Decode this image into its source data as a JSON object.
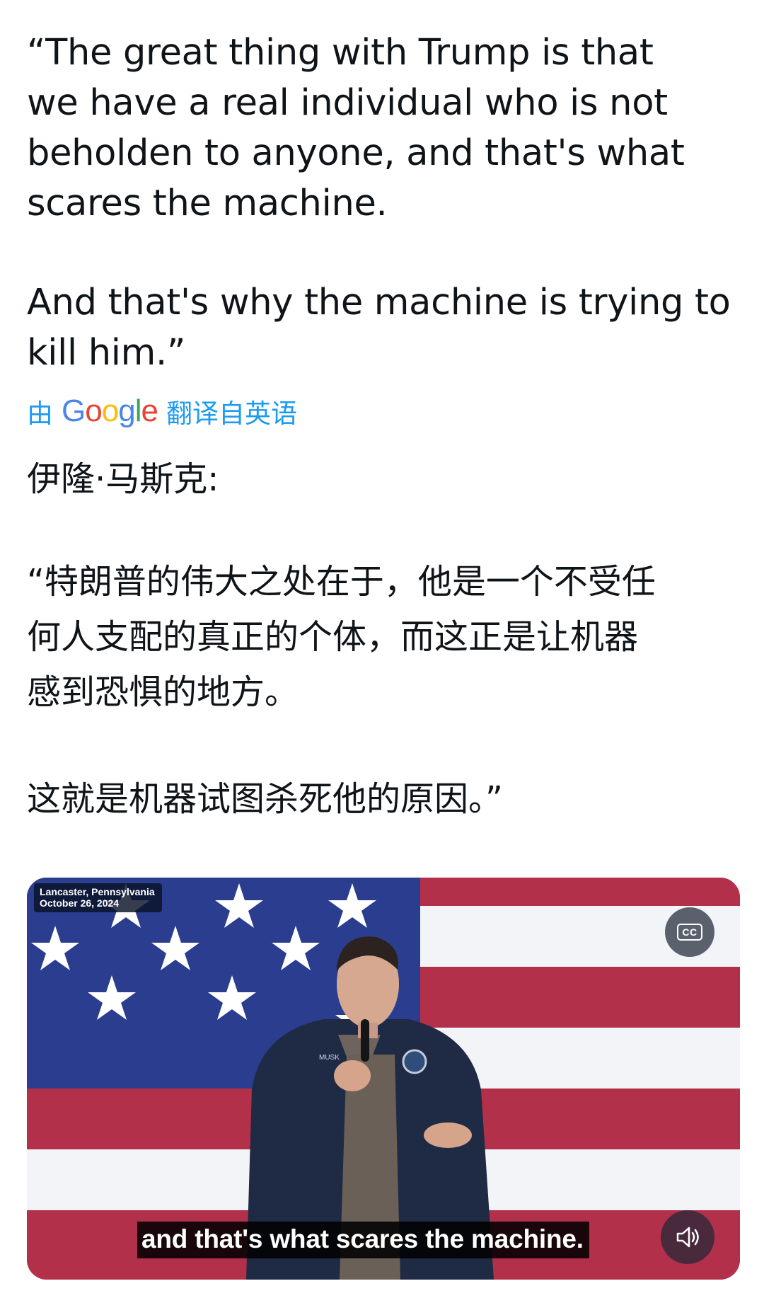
{
  "post": {
    "original_text_p1": "“The great thing with Trump is that\nwe have a real individual who is not\nbeholden to anyone, and that's what\nscares the machine.",
    "original_text_p2": "And that's why the machine is trying to\nkill him.”",
    "translation_bar": {
      "prefix": "由",
      "provider_logo": "Google",
      "suffix": "翻译自英语"
    },
    "translated_author": "伊隆·马斯克:",
    "translated_text_p1": "“特朗普的伟大之处在于，他是一个不受任\n何人支配的真正的个体，而这正是让机器\n感到恐惧的地方。",
    "translated_text_p2": "这就是机器试图杀死他的原因。”"
  },
  "video": {
    "location": "Lancaster, Pennsylvania",
    "date": "October 26, 2024",
    "caption": "and that's what scares the machine.",
    "cc_label": "CC",
    "jacket_tag": "MUSK",
    "icons": {
      "captions": "cc-icon",
      "volume": "volume-icon"
    }
  },
  "colors": {
    "text": "#0f1419",
    "link": "#1d9bf0",
    "flag_red": "#b3304a",
    "flag_blue": "#2a3d8f",
    "flag_white": "#f2f4f8"
  }
}
